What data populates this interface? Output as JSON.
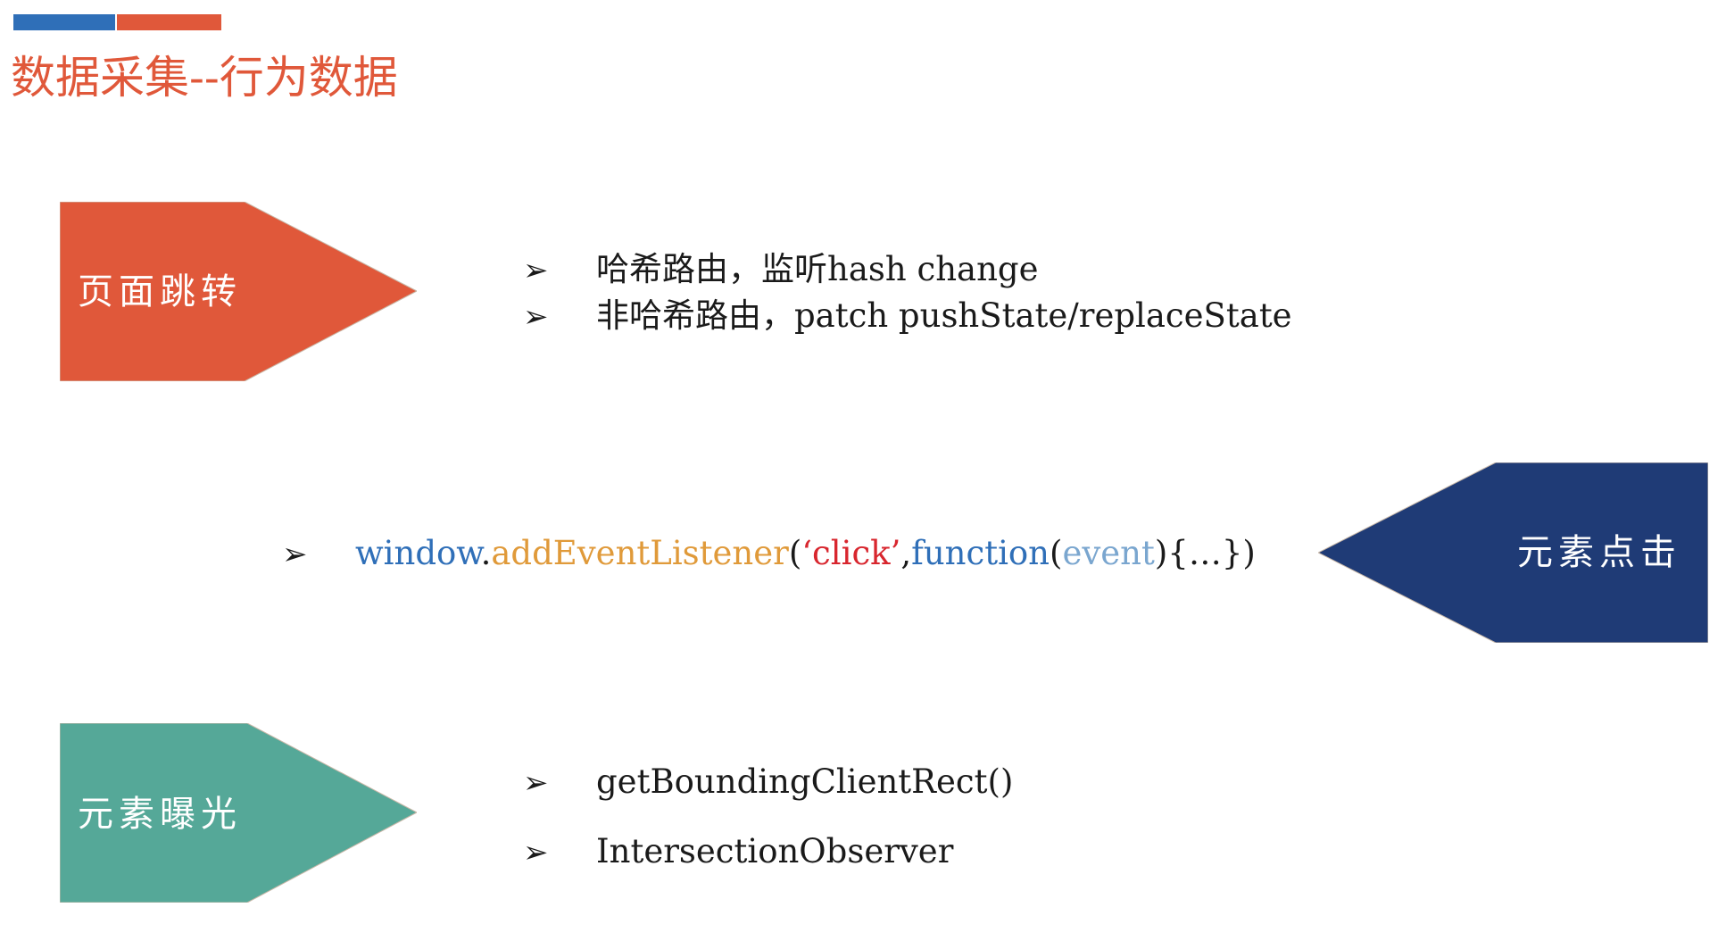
{
  "title": "数据采集--行为数据",
  "colors": {
    "accent_blue": "#2f6fb8",
    "accent_orange": "#e0583a",
    "page_jump": "#e0583a",
    "element_click": "#1f3b76",
    "element_exposure": "#55a898"
  },
  "sections": {
    "page_jump": {
      "label": "页面跳转",
      "bullets": [
        "哈希路由，监听hash change",
        "非哈希路由，patch pushState/replaceState"
      ]
    },
    "element_click": {
      "label": "元素点击",
      "code": {
        "object": "window",
        "dot": ".",
        "method": "addEventListener",
        "open_paren": "(",
        "string": "‘click’",
        "comma": ",",
        "keyword": "function",
        "param_open": "(",
        "param": "event",
        "param_close": ")",
        "body": "{…})"
      }
    },
    "element_exposure": {
      "label": "元素曝光",
      "bullets": [
        "getBoundingClientRect()",
        "IntersectionObserver"
      ]
    }
  },
  "bullet_glyph": "➢"
}
